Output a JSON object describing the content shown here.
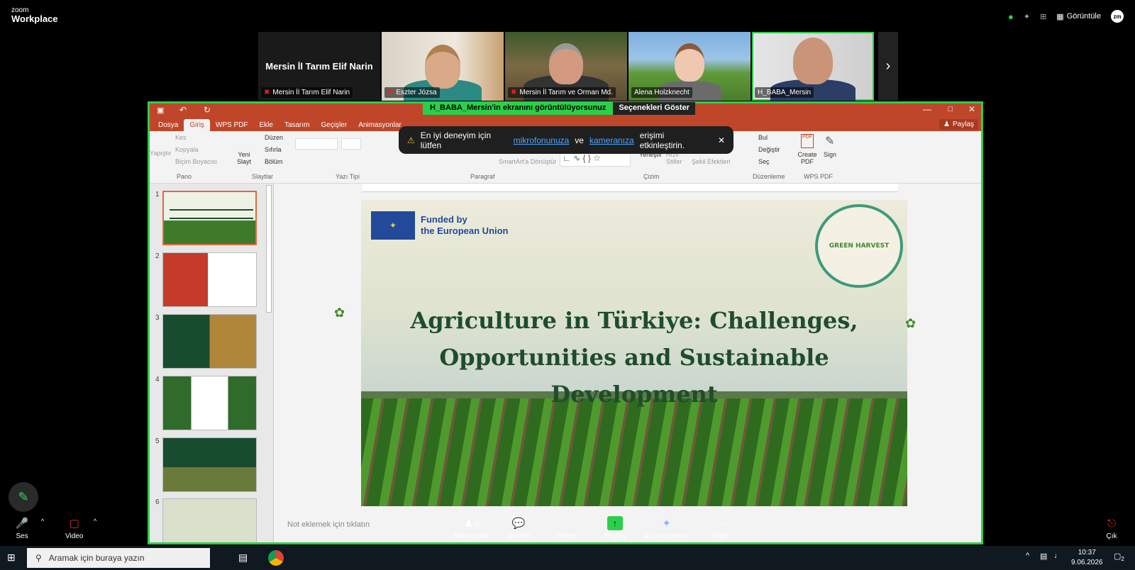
{
  "zoom": {
    "brand_top": "zoom",
    "brand_bottom": "Workplace",
    "view_label": "Görüntüle",
    "avatar_initials": "zm"
  },
  "participants": [
    {
      "caption": "Mersin İl Tarım Elif Narin",
      "big_name": "Mersin İl Tarım Elif Narin",
      "muted": true
    },
    {
      "caption": "Eszter Józsa",
      "muted": true
    },
    {
      "caption": "Mersin İl Tarım ve Orman Md.",
      "muted": true
    },
    {
      "caption": "Alena Holzknecht",
      "muted": false
    },
    {
      "caption": "H_BABA_Mersin",
      "muted": false
    }
  ],
  "share_banner": {
    "sharing_text": "H_BABA_Mersin'in ekranını görüntülüyorsunuz",
    "options": "Seçenekleri Göster"
  },
  "warning": {
    "pre": "En iyi deneyim için lütfen",
    "link1": "mikrofonunuza",
    "mid": "ve",
    "link2": "kameranıza",
    "post": "erişimi etkinleştirin."
  },
  "ppt": {
    "tabs": [
      "Dosya",
      "Giriş",
      "WPS PDF",
      "Ekle",
      "Tasarım",
      "Geçişler",
      "Animasyonlar"
    ],
    "share_label": "Paylaş",
    "ribbon": {
      "paste": "Yapıştır",
      "cut": "Kes",
      "copy": "Kopyala",
      "format_painter": "Biçim Boyacısı",
      "group_clipboard": "Pano",
      "new_slide": "Yeni Slayt",
      "layout": "Düzen",
      "reset": "Sıfırla",
      "section": "Bölüm",
      "group_slides": "Slaytlar",
      "group_font": "Yazı Tipi",
      "group_paragraph": "Paragraf",
      "smartart": "SmartArt'a Dönüştür",
      "arrange": "Yerleştir",
      "quick_styles": "Hızlı Stiller",
      "shape_effects": "Şekil Efektleri",
      "group_drawing": "Çizim",
      "find": "Bul",
      "replace": "Değiştir",
      "select": "Seç",
      "group_editing": "Düzenleme",
      "create_pdf": "Create PDF",
      "sign": "Sign",
      "group_wps": "WPS PDF"
    },
    "thumb_numbers": [
      "1",
      "2",
      "3",
      "4",
      "5",
      "6"
    ],
    "notes_placeholder": "Not eklemek için tıklatın",
    "slide": {
      "eu_line1": "Funded by",
      "eu_line2": "the European Union",
      "title_line1": "Agriculture in Türkiye: Challenges,",
      "title_line2": "Opportunities and Sustainable Development",
      "logo_text": "GREEN HARVEST"
    }
  },
  "toolbar": {
    "audio": "Ses",
    "video": "Video",
    "participants": "Katılımcılar",
    "participants_count": "15",
    "chat": "Sohbet",
    "react": "React",
    "share": "Paylaş",
    "ai": "AI Companion",
    "more": "Diğer",
    "leave": "Çık"
  },
  "taskbar": {
    "search_placeholder": "Aramak için buraya yazın",
    "time": "10:37",
    "date": "9.06.2026",
    "notifications": "2"
  },
  "colors": {
    "zoom_green": "#2bd04a",
    "ppt_red": "#c0462a",
    "slide_title_green": "#1f4d2c"
  }
}
